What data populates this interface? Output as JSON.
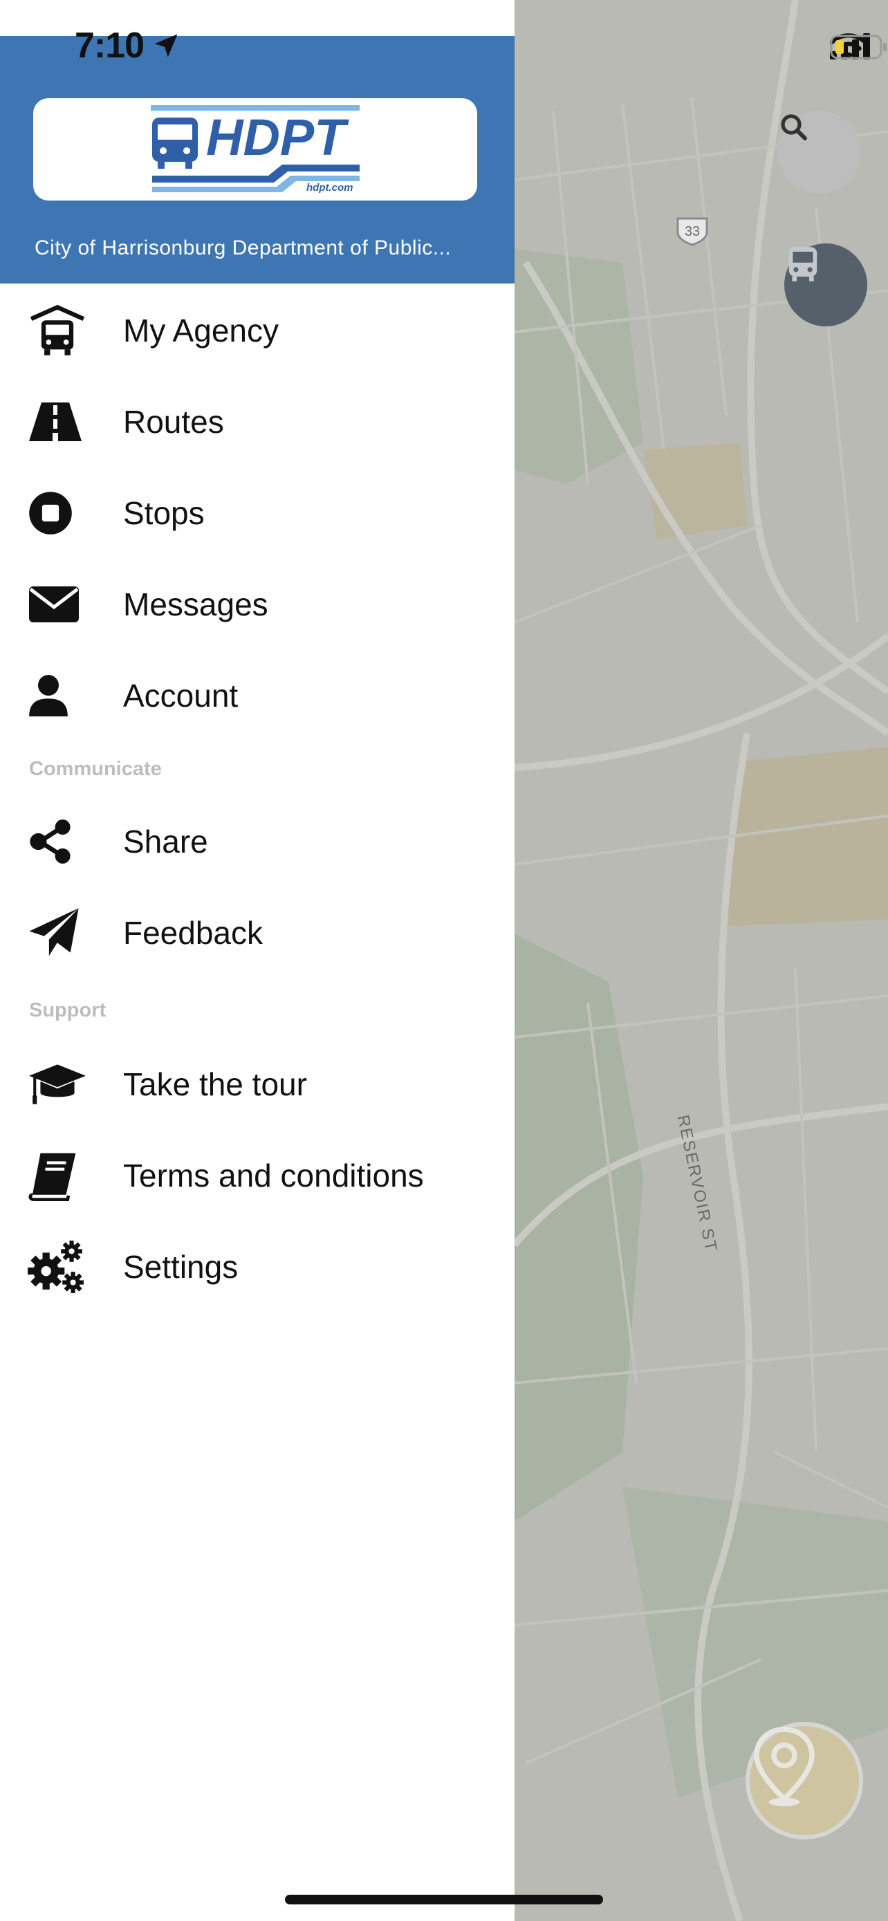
{
  "status_bar": {
    "time": "7:10"
  },
  "header": {
    "logo_text": "HDPT",
    "logo_url_text": "hdpt.com",
    "agency_name": "City of Harrisonburg Department of Public..."
  },
  "menu": [
    {
      "label": "My Agency",
      "icon": "agency-bus-icon"
    },
    {
      "label": "Routes",
      "icon": "road-icon"
    },
    {
      "label": "Stops",
      "icon": "stop-icon"
    },
    {
      "label": "Messages",
      "icon": "envelope-icon"
    },
    {
      "label": "Account",
      "icon": "user-icon"
    }
  ],
  "sections": {
    "communicate": "Communicate",
    "support": "Support"
  },
  "communicate_items": [
    {
      "label": "Share",
      "icon": "share-icon"
    },
    {
      "label": "Feedback",
      "icon": "paper-plane-icon"
    }
  ],
  "support_items": [
    {
      "label": "Take the tour",
      "icon": "graduation-cap-icon"
    },
    {
      "label": "Terms and conditions",
      "icon": "book-icon"
    },
    {
      "label": "Settings",
      "icon": "gears-icon"
    }
  ],
  "map": {
    "road_label": "RESERVOIR ST",
    "route_shield": "33"
  },
  "colors": {
    "header_blue": "#3d76b3",
    "logo_blue": "#2f5fa8",
    "logo_light_blue": "#7fb6e3"
  }
}
